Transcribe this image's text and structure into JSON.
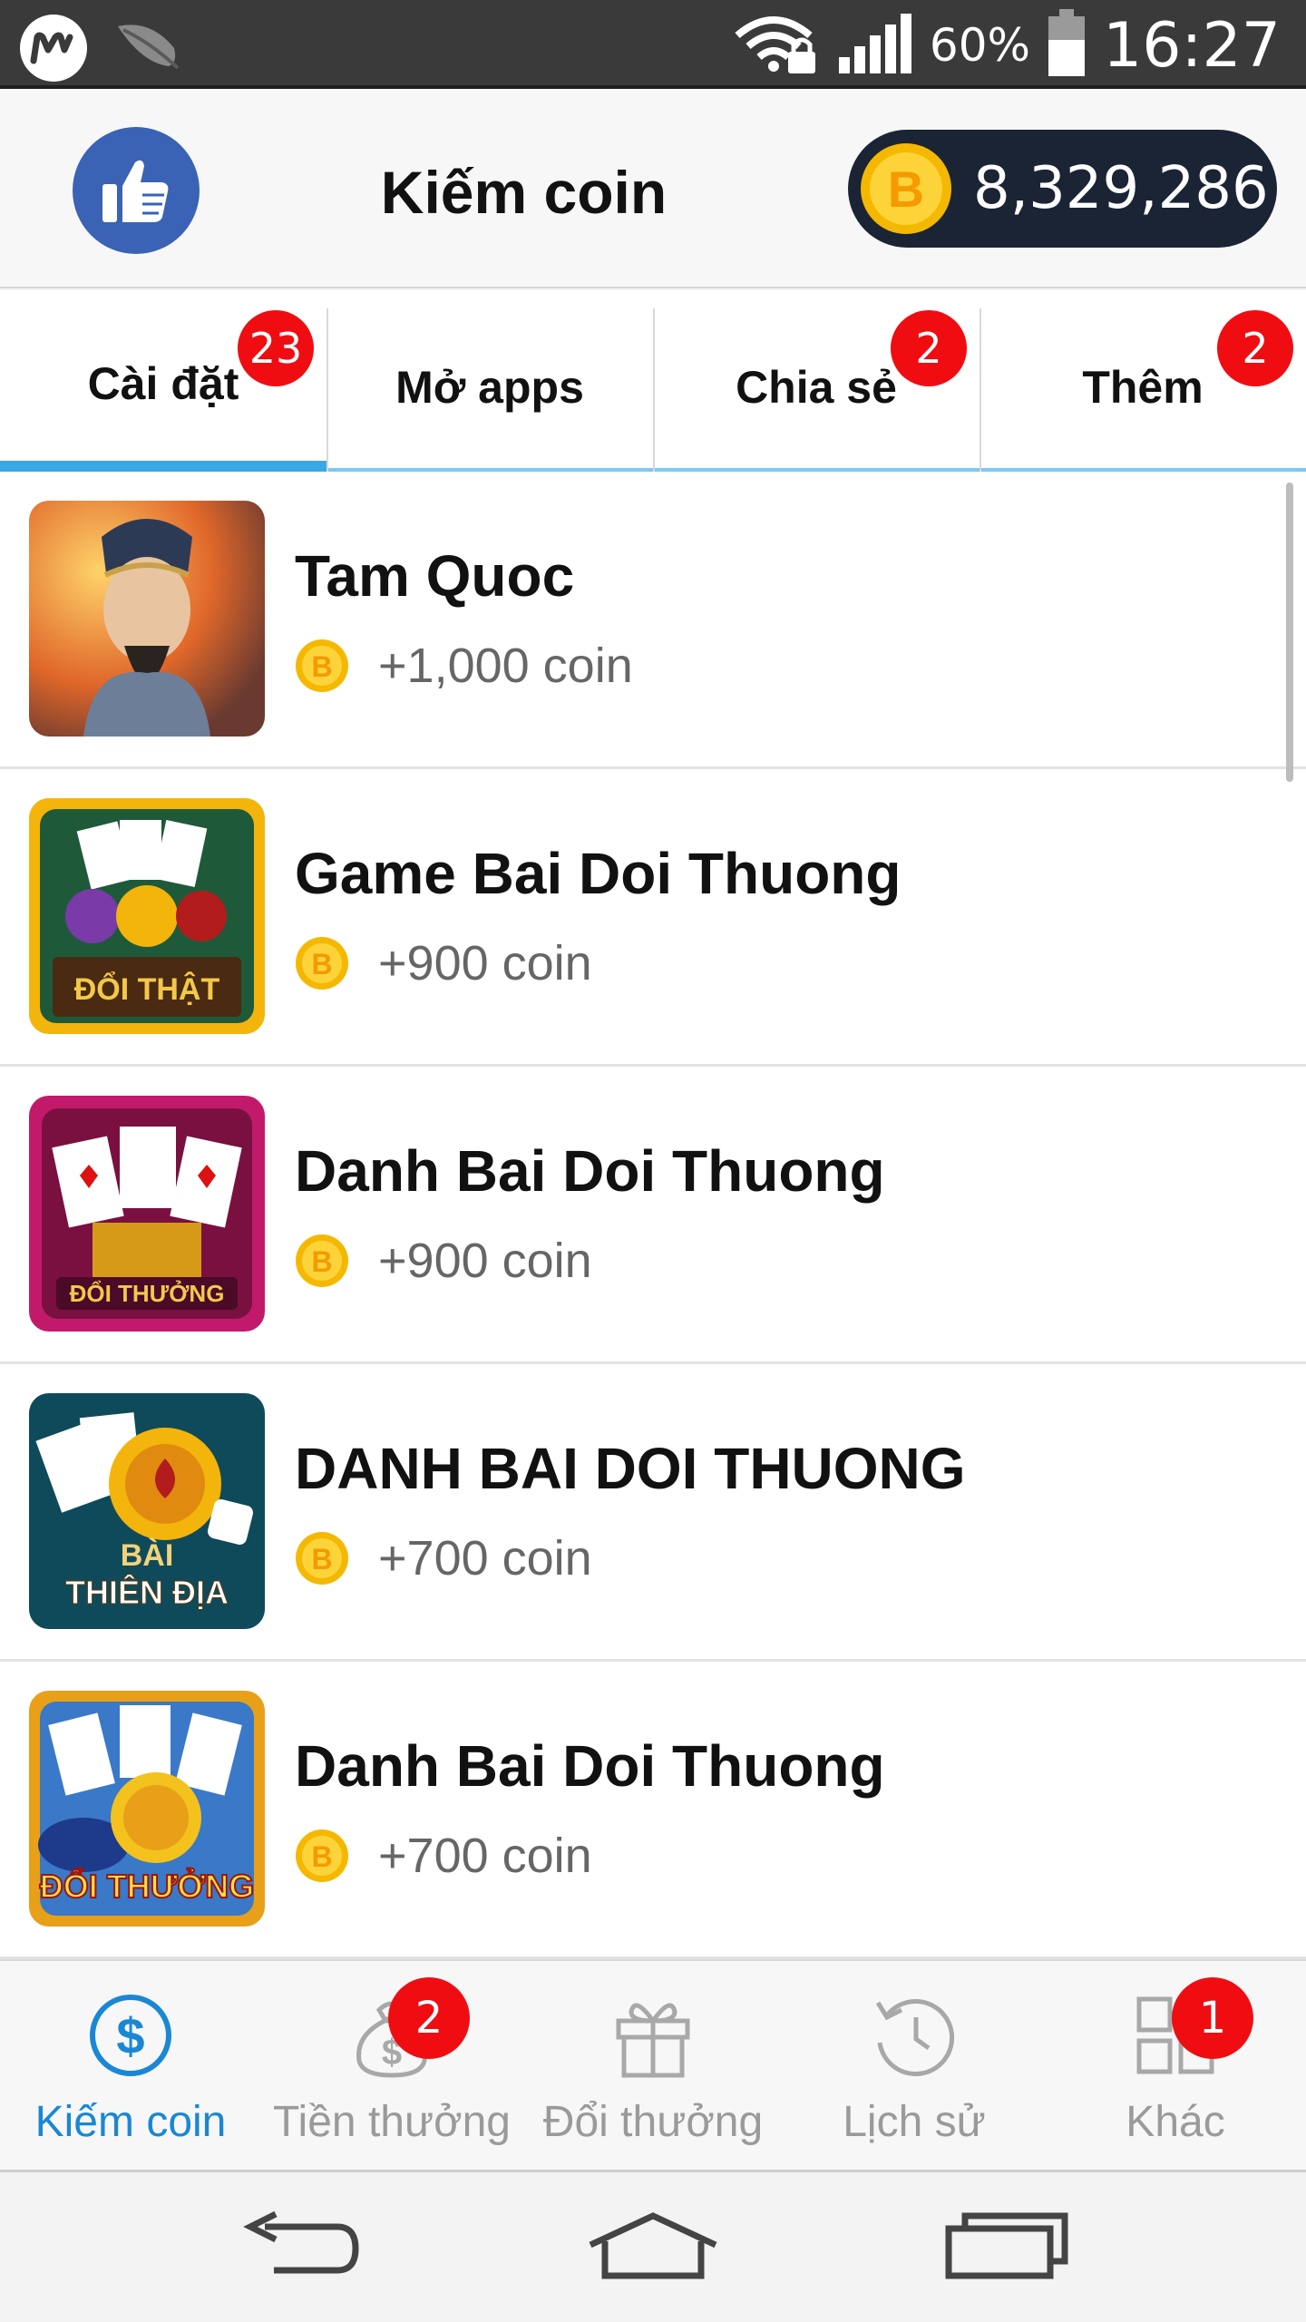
{
  "status_bar": {
    "battery": "60%",
    "time": "16:27"
  },
  "header": {
    "title": "Kiếm coin",
    "coin_balance": "8,329,286",
    "coin_symbol": "B"
  },
  "tabs": [
    {
      "label": "Cài đặt",
      "badge": "23",
      "active": true
    },
    {
      "label": "Mở apps",
      "badge": ""
    },
    {
      "label": "Chia sẻ",
      "badge": "2"
    },
    {
      "label": "Thêm",
      "badge": "2"
    }
  ],
  "apps": [
    {
      "name": "Tam Quoc",
      "reward": "+1,000 coin"
    },
    {
      "name": "Game Bai Doi Thuong",
      "reward": "+900 coin",
      "icon_text": "ĐỔI THẬT"
    },
    {
      "name": "Danh Bai Doi Thuong",
      "reward": "+900 coin",
      "icon_text": "ĐỔI THƯỞNG"
    },
    {
      "name": "DANH BAI DOI THUONG",
      "reward": "+700 coin",
      "icon_text_top": "BÀI",
      "icon_text": "THIÊN ĐỊA"
    },
    {
      "name": "Danh Bai Doi Thuong",
      "reward": "+700 coin",
      "icon_text": "ĐỔI THƯỞNG"
    }
  ],
  "bottom_nav": [
    {
      "label": "Kiếm coin",
      "icon": "dollar-circle-icon",
      "active": true
    },
    {
      "label": "Tiền thưởng",
      "icon": "money-bag-icon",
      "badge": "2"
    },
    {
      "label": "Đổi thưởng",
      "icon": "gift-icon"
    },
    {
      "label": "Lịch sử",
      "icon": "history-icon"
    },
    {
      "label": "Khác",
      "icon": "grid-icon",
      "badge": "1"
    }
  ],
  "colors": {
    "accent": "#3aa8e4",
    "badge": "#f00d12",
    "active_nav": "#1a87d4",
    "like": "#3a62b5",
    "coin_pill": "#1b2435",
    "coin_gold": "#f5b800"
  }
}
